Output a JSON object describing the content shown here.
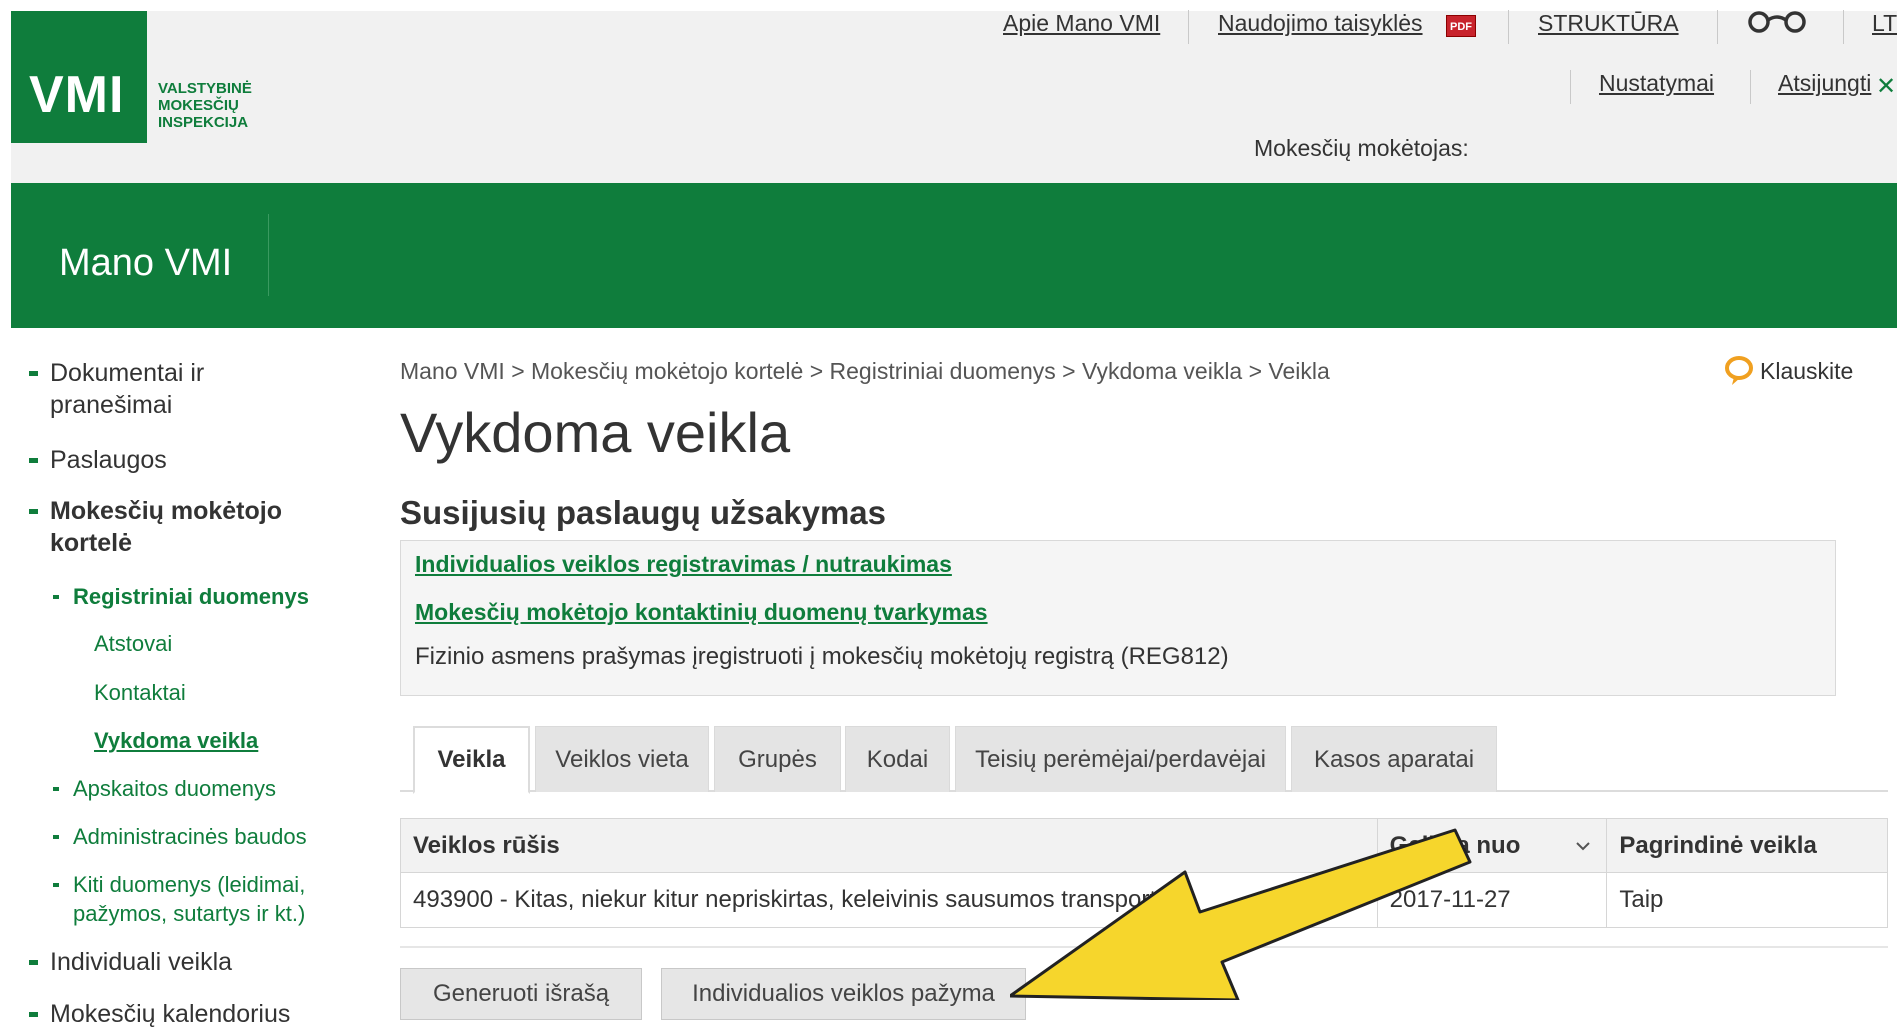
{
  "header": {
    "logo_mark": "VMI",
    "logo_lines": [
      "VALSTYBINĖ",
      "MOKESČIŲ",
      "INSPEKCIJA"
    ],
    "links": {
      "about": "Apie Mano VMI",
      "rules": "Naudojimo taisyklės",
      "structure": "STRUKTŪRA",
      "language": "LT",
      "settings": "Nustatymai",
      "logout": "Atsijungti"
    },
    "pdf_badge": "PDF",
    "close_glyph": "✕",
    "payer_label": "Mokesčių mokėtojas:",
    "band_title": "Mano VMI",
    "icons": [
      "pdf-icon",
      "glasses-icon",
      "close-icon"
    ]
  },
  "sidebar": {
    "items": [
      {
        "label_line1": "Dokumentai ir",
        "label_line2": "pranešimai"
      },
      {
        "label": "Paslaugos"
      },
      {
        "label_line1": "Mokesčių mokėtojo",
        "label_line2": "kortelė"
      },
      {
        "label": "Registriniai duomenys"
      },
      {
        "label": "Atstovai"
      },
      {
        "label": "Kontaktai"
      },
      {
        "label": "Vykdoma veikla"
      },
      {
        "label": "Apskaitos duomenys"
      },
      {
        "label": "Administracinės baudos"
      },
      {
        "label_line1": "Kiti duomenys (leidimai,",
        "label_line2": "pažymos, sutartys ir kt.)"
      },
      {
        "label": "Individuali veikla"
      },
      {
        "label": "Mokesčių kalendorius"
      }
    ]
  },
  "main": {
    "breadcrumb": "Mano VMI > Mokesčių mokėtojo kortelė > Registriniai duomenys > Vykdoma veikla > Veikla",
    "ask_label": "Klauskite",
    "page_title": "Vykdoma veikla",
    "section_title": "Susijusių paslaugų užsakymas",
    "services": {
      "link1": "Individualios veiklos registravimas / nutraukimas",
      "link2": "Mokesčių mokėtojo kontaktinių duomenų tvarkymas",
      "text": "Fizinio asmens prašymas įregistruoti į mokesčių mokėtojų registrą (REG812)"
    },
    "tabs": [
      {
        "label": "Veikla",
        "active": true
      },
      {
        "label": "Veiklos vieta"
      },
      {
        "label": "Grupės"
      },
      {
        "label": "Kodai"
      },
      {
        "label": "Teisių perėmėjai/perdavėjai"
      },
      {
        "label": "Kasos aparatai"
      }
    ],
    "table": {
      "columns": [
        "Veiklos rūšis",
        "Galioja nuo",
        "Pagrindinė veikla"
      ],
      "rows": [
        [
          "493900 - Kitas, niekur kitur nepriskirtas, keleivinis sausumos transportas",
          "2017-11-27",
          "Taip"
        ]
      ]
    },
    "buttons": {
      "generate": "Generuoti išrašą",
      "certificate": "Individualios veiklos pažyma"
    }
  },
  "colors": {
    "brand_green": "#0f7d3c",
    "header_grey": "#f1f1f1",
    "arrow_yellow": "#f6d62c",
    "ask_orange": "#f0a020"
  }
}
